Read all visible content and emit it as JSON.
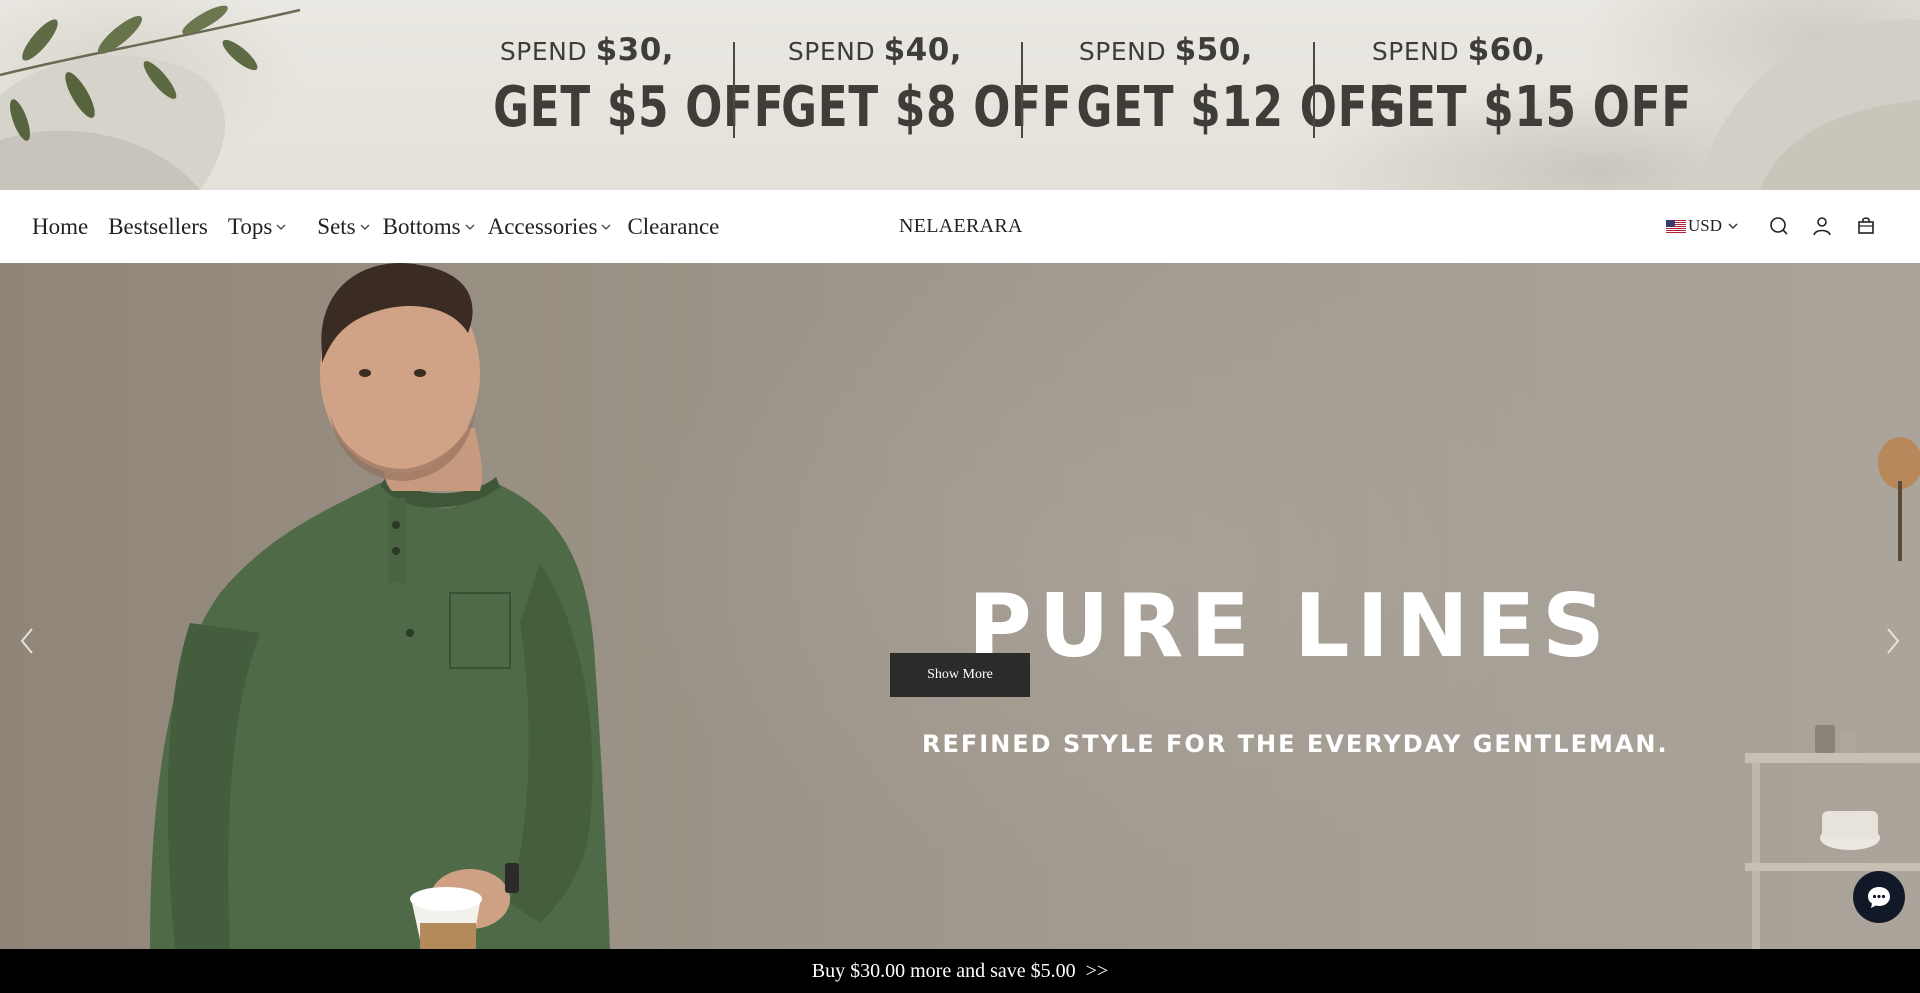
{
  "promo": {
    "offers": [
      {
        "spend_label": "SPEND",
        "spend_amount": "$30,",
        "discount": "GET $5 OFF"
      },
      {
        "spend_label": "SPEND",
        "spend_amount": "$40,",
        "discount": "GET $8 OFF"
      },
      {
        "spend_label": "SPEND",
        "spend_amount": "$50,",
        "discount": "GET $12 OFF"
      },
      {
        "spend_label": "SPEND",
        "spend_amount": "$60,",
        "discount": "GET $15 OFF"
      }
    ]
  },
  "header": {
    "nav": [
      {
        "label": "Home",
        "has_dropdown": false
      },
      {
        "label": "Bestsellers",
        "has_dropdown": false
      },
      {
        "label": "Tops",
        "has_dropdown": true
      },
      {
        "label": "Sets",
        "has_dropdown": true
      },
      {
        "label": "Bottoms",
        "has_dropdown": true
      },
      {
        "label": "Accessories",
        "has_dropdown": true
      },
      {
        "label": "Clearance",
        "has_dropdown": false
      }
    ],
    "brand": "NELAERARA",
    "currency": "USD",
    "icons": [
      "search-icon",
      "account-icon",
      "cart-icon"
    ]
  },
  "hero": {
    "title": "PURE LINES",
    "subtitle": "REFINED STYLE FOR THE EVERYDAY GENTLEMAN.",
    "cta_label": "Show More",
    "prev_icon": "chevron-left-icon",
    "next_icon": "chevron-right-icon"
  },
  "chat": {
    "icon": "chat-bubble-icon"
  },
  "bottom_bar": {
    "text": "Buy $30.00 more and save $5.00",
    "arrow": ">>"
  },
  "colors": {
    "banner_bg": "#e6e3dc",
    "offer_text": "#3e3d37",
    "hero_bg": "#a39b91",
    "shirt_green": "#4f6a46",
    "cta_bg": "#2b2b2b",
    "bottom_bar_bg": "#000000",
    "chat_bg": "#111827"
  }
}
